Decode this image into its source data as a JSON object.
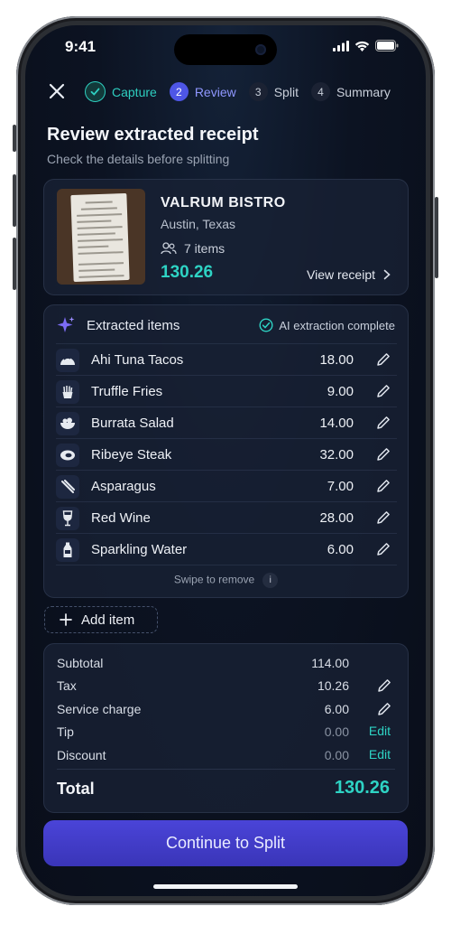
{
  "status_bar": {
    "time": "9:41"
  },
  "stepper": {
    "steps": [
      {
        "num": "✓",
        "label": "Capture",
        "state": "done"
      },
      {
        "num": "2",
        "label": "Review",
        "state": "active"
      },
      {
        "num": "3",
        "label": "Split",
        "state": "todo"
      },
      {
        "num": "4",
        "label": "Summary",
        "state": "todo"
      }
    ]
  },
  "header": {
    "title": "Review extracted receipt",
    "subtitle": "Check the details before splitting"
  },
  "receipt": {
    "restaurant": "VALRUM BISTRO",
    "location": "Austin, Texas",
    "items_count": "7 items",
    "total": "130.26",
    "view_receipt": "View receipt"
  },
  "items_section": {
    "title": "Extracted items",
    "ai_status": "AI extraction complete",
    "swipe_hint": "Swipe to remove",
    "items": [
      {
        "name": "Ahi Tuna Tacos",
        "price": "18.00",
        "icon": "taco-icon"
      },
      {
        "name": "Truffle Fries",
        "price": "9.00",
        "icon": "fries-icon"
      },
      {
        "name": "Burrata Salad",
        "price": "14.00",
        "icon": "salad-icon"
      },
      {
        "name": "Ribeye Steak",
        "price": "32.00",
        "icon": "steak-icon"
      },
      {
        "name": "Asparagus",
        "price": "7.00",
        "icon": "asparagus-icon"
      },
      {
        "name": "Red Wine",
        "price": "28.00",
        "icon": "wine-glass-icon"
      },
      {
        "name": "Sparkling Water",
        "price": "6.00",
        "icon": "bottle-icon"
      }
    ]
  },
  "add_item_label": "Add item",
  "totals": {
    "subtotal_label": "Subtotal",
    "subtotal": "114.00",
    "tax_label": "Tax",
    "tax": "10.26",
    "service_label": "Service charge",
    "service": "6.00",
    "tip_label": "Tip",
    "tip": "0.00",
    "tip_action": "Edit",
    "discount_label": "Discount",
    "discount": "0.00",
    "discount_action": "Edit",
    "total_label": "Total",
    "total": "130.26"
  },
  "cta_label": "Continue to Split",
  "colors": {
    "accent_teal": "#2ed3c4",
    "accent_indigo": "#4e56e6",
    "background": "#0c1322"
  }
}
